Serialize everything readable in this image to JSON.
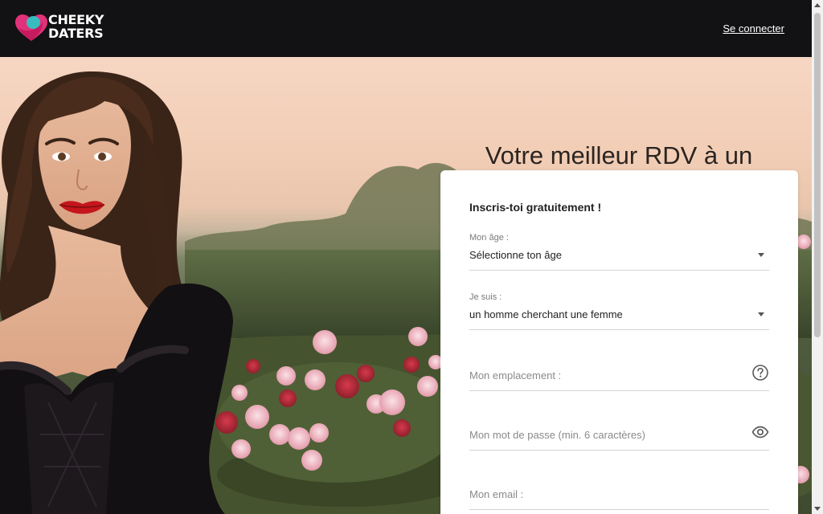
{
  "header": {
    "logo_line1": "CHEEKY",
    "logo_line2": "DATERS",
    "login_link": "Se connecter"
  },
  "hero": {
    "headline": "Votre meilleur RDV à un clic."
  },
  "form": {
    "title": "Inscris-toi gratuitement !",
    "age": {
      "label": "Mon âge :",
      "value": "Sélectionne ton âge",
      "icon": "chevron-down-icon"
    },
    "gender": {
      "label": "Je suis :",
      "value": "un homme cherchant une femme",
      "icon": "chevron-down-icon"
    },
    "location": {
      "placeholder": "Mon emplacement :",
      "icon": "help-icon"
    },
    "password": {
      "placeholder": "Mon mot de passe (min. 6 caractères)",
      "icon": "eye-icon"
    },
    "email": {
      "placeholder": "Mon email :"
    }
  },
  "colors": {
    "topbar": "#121114",
    "logo_pink": "#e0327a",
    "logo_teal": "#2ec4c4",
    "text_dark": "#2b2420"
  }
}
